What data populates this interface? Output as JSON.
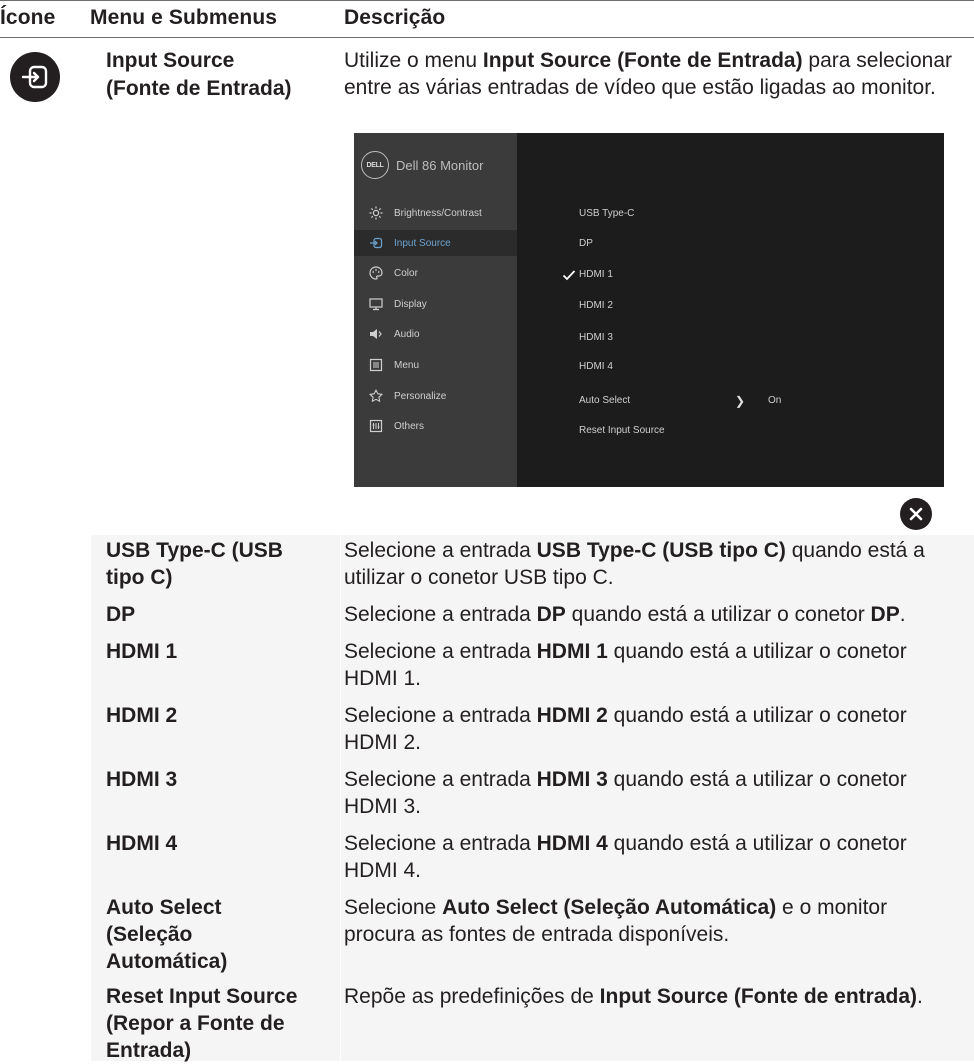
{
  "header": {
    "col_icon": "Ícone",
    "col_menu": "Menu e Submenus",
    "col_desc": "Descrição"
  },
  "intro": {
    "icon": "input-source-icon",
    "title_line1": "Input Source",
    "title_line2": "(Fonte de Entrada)",
    "desc_before": "Utilize o menu ",
    "desc_bold": "Input Source (Fonte de Entrada)",
    "desc_after": " para selecionar entre as várias entradas de vídeo que estão ligadas ao monitor."
  },
  "osd": {
    "brand": "DELL",
    "title": "Dell 86 Monitor",
    "menu": [
      {
        "label": "Brightness/Contrast",
        "icon": "brightness-icon"
      },
      {
        "label": "Input Source",
        "icon": "input-source-icon"
      },
      {
        "label": "Color",
        "icon": "color-palette-icon"
      },
      {
        "label": "Display",
        "icon": "display-icon"
      },
      {
        "label": "Audio",
        "icon": "speaker-icon"
      },
      {
        "label": "Menu",
        "icon": "menu-icon"
      },
      {
        "label": "Personalize",
        "icon": "star-icon"
      },
      {
        "label": "Others",
        "icon": "others-icon"
      }
    ],
    "submenu": [
      "USB Type-C",
      "DP",
      "HDMI 1",
      "HDMI 2",
      "HDMI 3",
      "HDMI 4",
      "Auto Select",
      "Reset Input Source"
    ],
    "selected_input": "HDMI 1",
    "auto_select_value": "On",
    "selected_menu_color": "#6da3cf"
  },
  "close_icon": "close-icon",
  "rows": [
    {
      "name": "USB Type-C (USB tipo C)",
      "d1": "Selecione a entrada ",
      "b1": "USB Type-C (USB tipo C)",
      "d2": " quando está a utilizar o conetor USB tipo C.",
      "b2": "",
      "d3": ""
    },
    {
      "name": "DP",
      "d1": "Selecione a entrada ",
      "b1": "DP",
      "d2": " quando está a utilizar o conetor ",
      "b2": "DP",
      "d3": "."
    },
    {
      "name": "HDMI 1",
      "d1": "Selecione a entrada ",
      "b1": "HDMI 1",
      "d2": " quando está a utilizar o conetor HDMI 1.",
      "b2": "",
      "d3": ""
    },
    {
      "name": "HDMI 2",
      "d1": "Selecione a entrada ",
      "b1": "HDMI 2",
      "d2": " quando está a utilizar o conetor HDMI 2.",
      "b2": "",
      "d3": ""
    },
    {
      "name": "HDMI 3",
      "d1": "Selecione a entrada ",
      "b1": "HDMI 3",
      "d2": " quando está a utilizar o conetor HDMI 3.",
      "b2": "",
      "d3": ""
    },
    {
      "name": "HDMI 4",
      "d1": "Selecione a entrada ",
      "b1": "HDMI 4",
      "d2": " quando está a utilizar o conetor HDMI 4.",
      "b2": "",
      "d3": ""
    },
    {
      "name": "Auto Select (Seleção Automática)",
      "d1": "Selecione ",
      "b1": "Auto Select (Seleção Automática)",
      "d2": " e o monitor procura as fontes de entrada disponíveis.",
      "b2": "",
      "d3": ""
    },
    {
      "name": "Reset Input Source (Repor a Fonte de Entrada)",
      "d1": "Repõe as predefinições de ",
      "b1": "Input Source (Fonte de entrada)",
      "d2": ".",
      "b2": "",
      "d3": ""
    }
  ]
}
